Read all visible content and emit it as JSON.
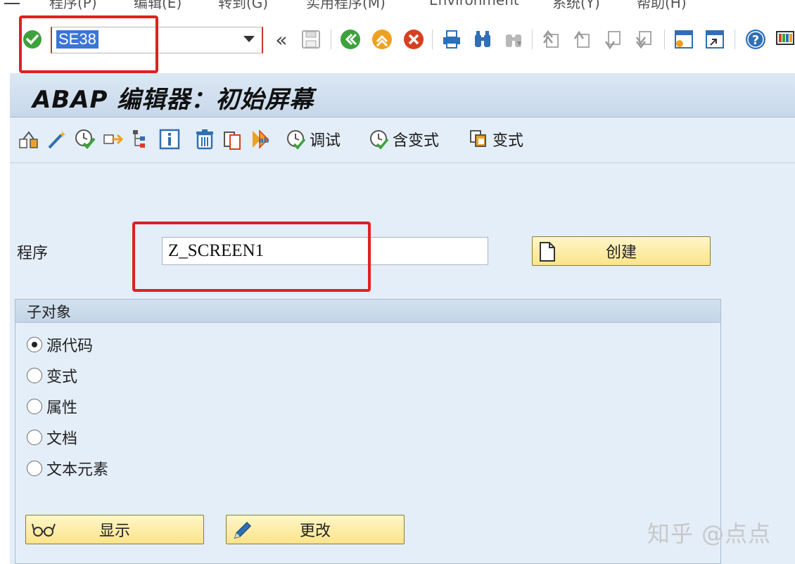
{
  "menu": {
    "items": [
      "程序(P)",
      "编辑(E)",
      "转到(G)",
      "实用程序(M)",
      "Environment",
      "系统(Y)",
      "帮助(H)"
    ]
  },
  "toolbar": {
    "command_value": "SE38",
    "icons": [
      "enter-icon",
      "back-icon",
      "exit-icon",
      "cancel-icon",
      "print-icon",
      "find-icon",
      "find-next-icon",
      "first-page-icon",
      "previous-page-icon",
      "next-page-icon",
      "last-page-icon",
      "create-session-icon",
      "shortcut-icon",
      "help-icon",
      "customize-layout-icon"
    ],
    "colors": {
      "green": "#3ca23c",
      "orange": "#f0a020",
      "red": "#d64020",
      "blue": "#2f6fb5"
    }
  },
  "title": "ABAP 编辑器：初始屏幕",
  "app_toolbar": {
    "debug_label": "调试",
    "with_variant_label": "含变式",
    "variants_label": "变式"
  },
  "form": {
    "program_label": "程序",
    "program_value": "Z_SCREEN1",
    "create_label": "创建"
  },
  "subobjects": {
    "title": "子对象",
    "options": [
      "源代码",
      "变式",
      "属性",
      "文档",
      "文本元素"
    ],
    "selected_index": 0
  },
  "actions": {
    "display_label": "显示",
    "change_label": "更改"
  },
  "watermark": "知乎 @点点"
}
